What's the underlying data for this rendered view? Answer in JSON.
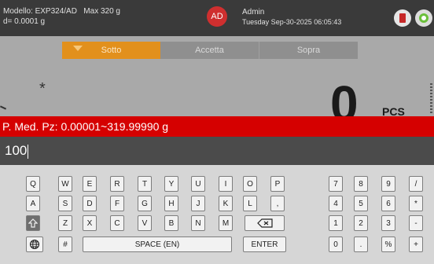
{
  "header": {
    "model": "Modello: EXP324/AD",
    "max": "Max 320 g",
    "resolution": "d= 0.0001 g",
    "avatar": "AD",
    "user": "Admin",
    "datetime": "Tuesday Sep-30-2025 06:05:43",
    "icons": [
      "usb-icon",
      "status-icon"
    ]
  },
  "tabs": [
    "Sotto",
    "Accetta",
    "Sopra"
  ],
  "display": {
    "marker": "*",
    "value": "0",
    "unit": "PCS"
  },
  "prompt": "P. Med. Pz: 0.00001~319.99990 g",
  "input": {
    "value": "100"
  },
  "keyboard": {
    "row1": [
      "Q",
      "W",
      "E",
      "R",
      "T",
      "Y",
      "U",
      "I",
      "O",
      "P"
    ],
    "row2": [
      "A",
      "S",
      "D",
      "F",
      "G",
      "H",
      "J",
      "K",
      "L",
      ","
    ],
    "row3": [
      "Z",
      "X",
      "C",
      "V",
      "B",
      "N",
      "M"
    ],
    "numrow1": [
      "7",
      "8",
      "9",
      "/"
    ],
    "numrow2": [
      "4",
      "5",
      "6",
      "*"
    ],
    "numrow3": [
      "1",
      "2",
      "3",
      "-"
    ],
    "numrow4": [
      "0",
      ".",
      "%",
      "+"
    ],
    "hash": "#",
    "space": "SPACE (EN)",
    "enter": "ENTER",
    "shift_icon": "shift-icon",
    "globe_icon": "globe-icon",
    "backspace_icon": "backspace-icon"
  },
  "colors": {
    "topbar": "#3a3a3a",
    "accent": "#e2901c",
    "alert": "#d50000",
    "avatar": "#cf2f2f"
  }
}
